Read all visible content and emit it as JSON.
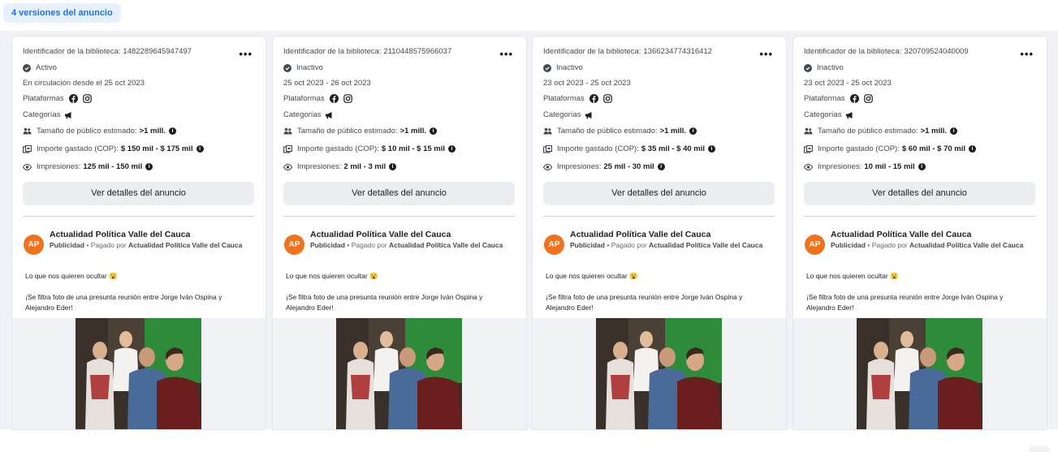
{
  "versions_label": "4 versiones del anuncio",
  "common": {
    "library_id_label": "Identificador de la biblioteca:",
    "platforms_label": "Plataformas",
    "categories_label": "Categorías",
    "audience_label": "Tamaño de público estimado:",
    "audience_value": ">1 mill.",
    "spend_label": "Importe gastado (COP):",
    "impressions_label": "Impresiones:",
    "details_button": "Ver detalles del anuncio",
    "page_name": "Actualidad Política Valle del Cauca",
    "sponsored_label": "Publicidad",
    "paid_by_label": "Pagado por",
    "paid_by_value": "Actualidad Política Valle del Cauca",
    "avatar_text": "AP",
    "body_line1": "Lo que nos quieren ocultar 😮",
    "body_line2": "¡Se filtra foto de una presunta reunión entre Jorge Iván Ospina y Alejandro Eder!",
    "menu_glyph": "•••"
  },
  "cards": [
    {
      "library_id": "1482289645947497",
      "status": "Activo",
      "dates": "En circulación desde el 25 oct 2023",
      "spend": "$ 150 mil - $ 175 mil",
      "impressions": "125 mil - 150 mil"
    },
    {
      "library_id": "2110448575966037",
      "status": "Inactivo",
      "dates": "25 oct 2023 - 26 oct 2023",
      "spend": "$ 10 mil - $ 15 mil",
      "impressions": "2 mil - 3 mil"
    },
    {
      "library_id": "1366234774316412",
      "status": "Inactivo",
      "dates": "23 oct 2023 - 25 oct 2023",
      "spend": "$ 35 mil - $ 40 mil",
      "impressions": "25 mil - 30 mil"
    },
    {
      "library_id": "320709524040009",
      "status": "Inactivo",
      "dates": "23 oct 2023 - 25 oct 2023",
      "spend": "$ 60 mil - $ 70 mil",
      "impressions": "10 mil - 15 mil"
    }
  ],
  "icons": {
    "status": "check-circle-icon",
    "platforms": [
      "facebook-icon",
      "instagram-icon"
    ],
    "categories": "megaphone-icon",
    "audience": "people-icon",
    "spend": "money-icon",
    "impressions": "eye-icon",
    "info": "info-icon"
  },
  "colors": {
    "accent": "#1a73e8",
    "avatar": "#f2711c",
    "button_bg": "#ebedf0"
  }
}
